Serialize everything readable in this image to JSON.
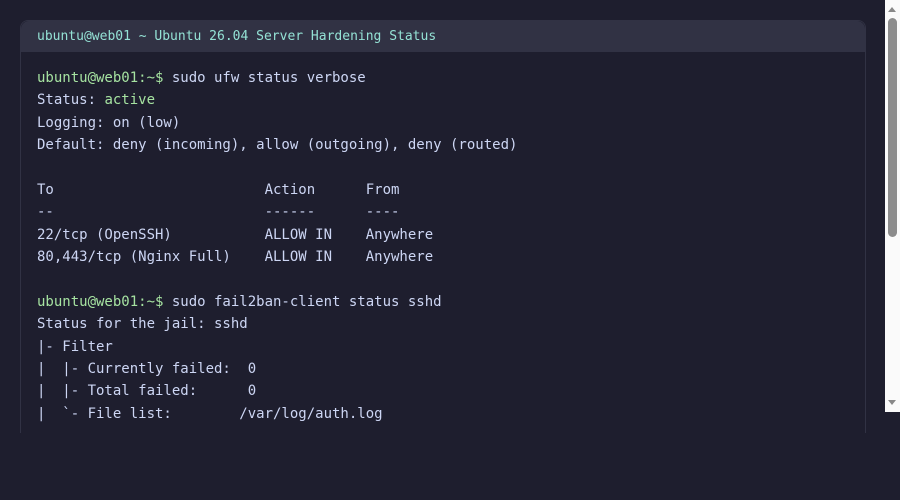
{
  "window": {
    "title": "ubuntu@web01 ~ Ubuntu 26.04 Server Hardening Status"
  },
  "terminal": {
    "prompt": "ubuntu@web01:~$ ",
    "commands": [
      "sudo ufw status verbose",
      "sudo fail2ban-client status sshd"
    ],
    "ufw": {
      "status_label": "Status: ",
      "status_value": "active",
      "logging": "Logging: on (low)",
      "default": "Default: deny (incoming), allow (outgoing), deny (routed)",
      "table_header": "To                         Action      From",
      "table_sep": "--                         ------      ----",
      "rows": [
        "22/tcp (OpenSSH)           ALLOW IN    Anywhere",
        "80,443/tcp (Nginx Full)    ALLOW IN    Anywhere"
      ]
    },
    "fail2ban": {
      "lines": [
        "Status for the jail: sshd",
        "|- Filter",
        "|  |- Currently failed:  0",
        "|  |- Total failed:      0",
        "|  `- File list:        /var/log/auth.log"
      ]
    }
  }
}
